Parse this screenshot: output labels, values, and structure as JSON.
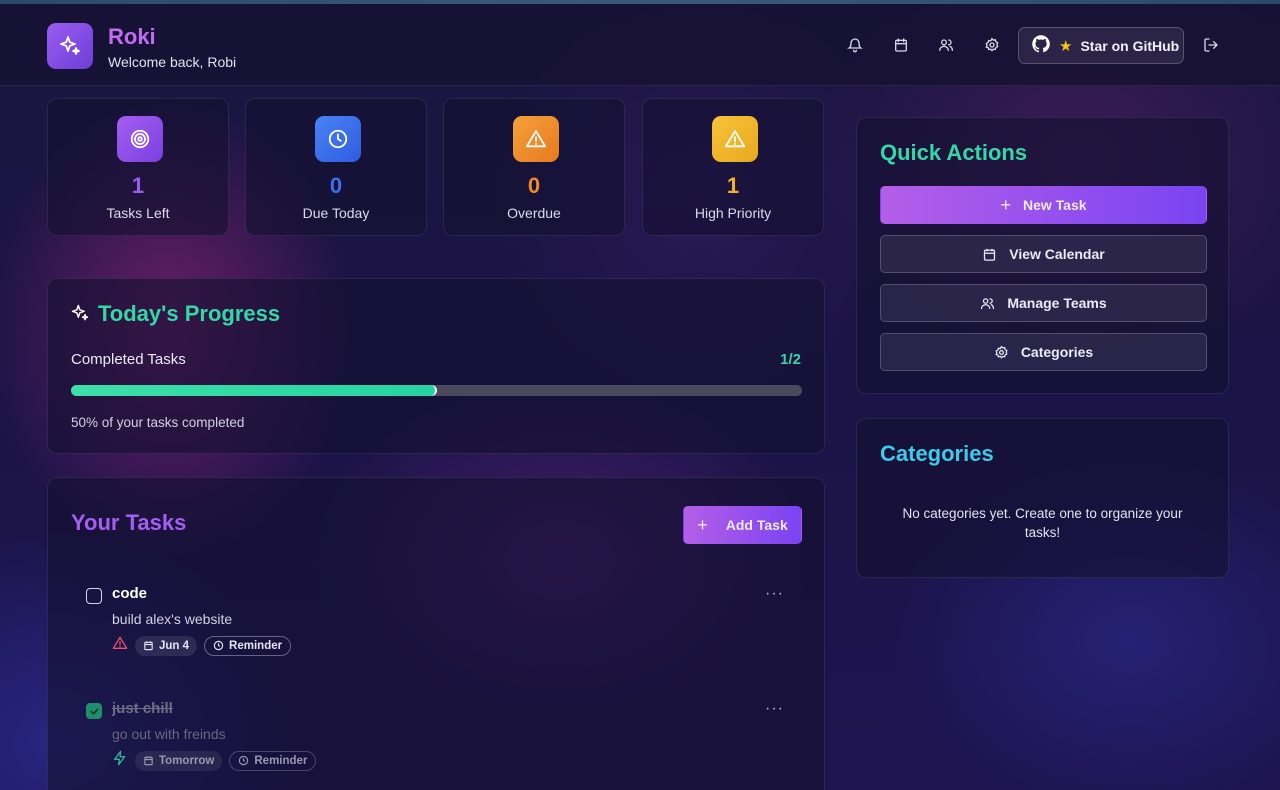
{
  "header": {
    "app_name": "Roki",
    "welcome": "Welcome back, Robi",
    "icons": [
      "bell-icon",
      "calendar-icon",
      "users-icon",
      "settings-icon"
    ],
    "github_label": "Star on GitHub",
    "logout_icon": "logout-icon"
  },
  "stats": [
    {
      "value": "1",
      "label": "Tasks Left",
      "icon": "target-icon",
      "color": "#9b5cf0"
    },
    {
      "value": "0",
      "label": "Due Today",
      "icon": "clock-icon",
      "color": "#3b6ef0"
    },
    {
      "value": "0",
      "label": "Overdue",
      "icon": "warning-icon",
      "color": "#f0892a"
    },
    {
      "value": "1",
      "label": "High Priority",
      "icon": "warning-icon",
      "color": "#f0b42a"
    }
  ],
  "progress": {
    "title": "Today's Progress",
    "label": "Completed Tasks",
    "count": "1/2",
    "fraction": 0.5,
    "caption": "50% of your tasks completed"
  },
  "tasks_section": {
    "title": "Your Tasks",
    "add_label": "Add Task",
    "tasks": [
      {
        "title": "code",
        "description": "build alex's website",
        "completed": false,
        "priority_icon": "warning-icon",
        "date": "Jun 4",
        "reminder": "Reminder"
      },
      {
        "title": "just chill",
        "description": "go out with freinds",
        "completed": true,
        "priority_icon": "zap-icon",
        "date": "Tomorrow",
        "reminder": "Reminder"
      }
    ]
  },
  "quick_actions": {
    "title": "Quick Actions",
    "buttons": [
      "New Task",
      "View Calendar",
      "Manage Teams",
      "Categories"
    ]
  },
  "categories": {
    "title": "Categories",
    "empty": "No categories yet. Create one to organize your tasks!"
  },
  "colors": {
    "accent_purple": "#c26cf2",
    "accent_green": "#34d8a6",
    "accent_cyan": "#3ccbe8"
  }
}
